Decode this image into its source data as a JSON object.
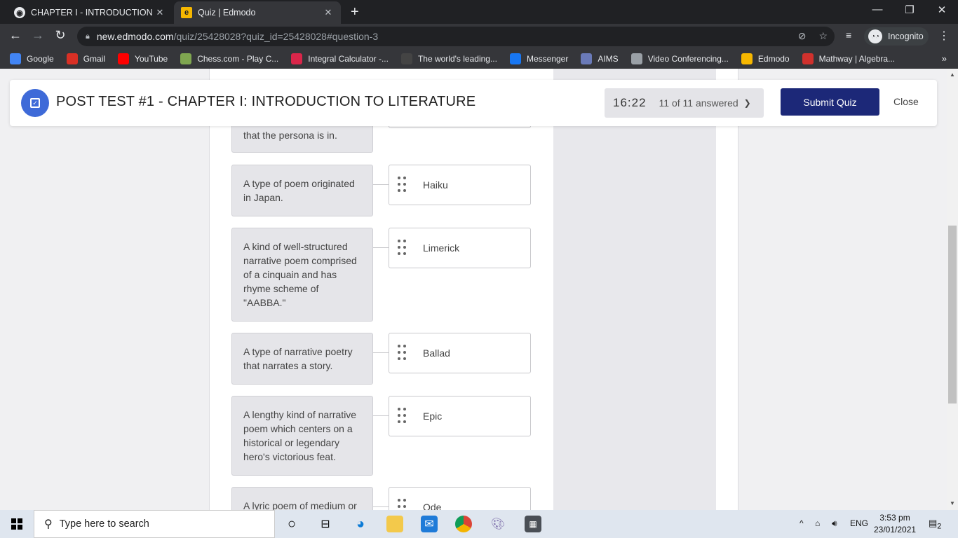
{
  "browser": {
    "tabs": [
      {
        "label": "CHAPTER I - INTRODUCTION TO",
        "close": "✕"
      },
      {
        "label": "Quiz | Edmodo",
        "close": "✕"
      }
    ],
    "new_tab": "+",
    "url_host": "new.edmodo.com",
    "url_path": "/quiz/25428028?quiz_id=25428028#question-3",
    "incognito_label": "Incognito",
    "bookmarks": [
      {
        "label": "Google",
        "icon": "google-icon",
        "color": "#4285f4"
      },
      {
        "label": "Gmail",
        "icon": "gmail-icon",
        "color": "#d93025"
      },
      {
        "label": "YouTube",
        "icon": "youtube-icon",
        "color": "#ff0000"
      },
      {
        "label": "Chess.com - Play C...",
        "icon": "chess-icon",
        "color": "#7fa650"
      },
      {
        "label": "Integral Calculator -...",
        "icon": "symbolab-icon",
        "color": "#d9264a"
      },
      {
        "label": "The world's leading...",
        "icon": "github-icon",
        "color": "#444444"
      },
      {
        "label": "Messenger",
        "icon": "messenger-icon",
        "color": "#1877f2"
      },
      {
        "label": "AIMS",
        "icon": "aims-icon",
        "color": "#6a7ab8"
      },
      {
        "label": "Video Conferencing...",
        "icon": "globe-icon",
        "color": "#9aa0a6"
      },
      {
        "label": "Edmodo",
        "icon": "edmodo-icon",
        "color": "#f6b700"
      },
      {
        "label": "Mathway | Algebra...",
        "icon": "mathway-icon",
        "color": "#d0312d"
      }
    ]
  },
  "quiz": {
    "title": "POST TEST #1 - CHAPTER I: INTRODUCTION TO LITERATURE",
    "timer": "16:22",
    "answered": "11 of 11 answered",
    "submit_label": "Submit Quiz",
    "close_label": "Close",
    "accent": "#1c2878",
    "prompts": [
      "that the persona is in.",
      "A type of poem originated in Japan.",
      "A kind of well-structured narrative poem comprised of a cinquain and has rhyme scheme of \"AABBA.\"",
      "A type of narrative poetry that narrates a story.",
      "A lengthy kind of narrative poem which centers on a historical or legendary hero's victorious feat.",
      "A lyric poem of medium or"
    ],
    "answers": [
      "",
      "Haiku",
      "Limerick",
      "Ballad",
      "Epic",
      "Ode"
    ]
  },
  "taskbar": {
    "search_placeholder": "Type here to search",
    "language": "ENG",
    "time": "3:53 pm",
    "date": "23/01/2021",
    "notification_count": "2"
  }
}
